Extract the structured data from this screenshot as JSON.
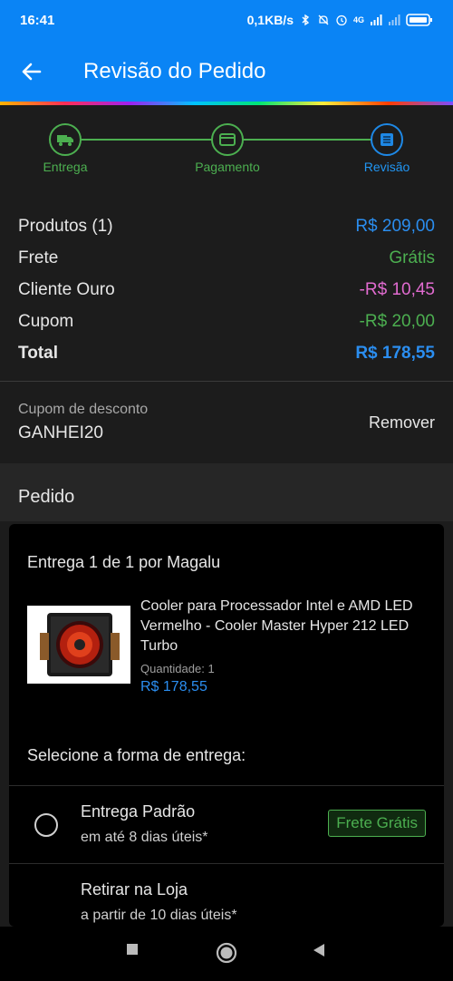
{
  "status_bar": {
    "time": "16:41",
    "speed": "0,1KB/s",
    "network": "4G",
    "icons": [
      "bluetooth-icon",
      "mute-icon",
      "alarm-icon",
      "signal-icon",
      "battery-icon"
    ]
  },
  "app_bar": {
    "title": "Revisão do Pedido",
    "back_icon": "arrow-left-icon"
  },
  "stepper": {
    "steps": [
      {
        "label": "Entrega",
        "icon": "truck-icon",
        "state": "done"
      },
      {
        "label": "Pagamento",
        "icon": "card-icon",
        "state": "done"
      },
      {
        "label": "Revisão",
        "icon": "list-icon",
        "state": "current"
      }
    ],
    "colors": {
      "done": "#4caf50",
      "current": "#1e88e5"
    }
  },
  "summary": {
    "rows": [
      {
        "label": "Produtos (1)",
        "value": "R$ 209,00",
        "color": "#2b8ef0"
      },
      {
        "label": "Frete",
        "value": "Grátis",
        "color": "#4caf50"
      },
      {
        "label": "Cliente Ouro",
        "value": "-R$ 10,45",
        "color": "#e16bd0"
      },
      {
        "label": "Cupom",
        "value": "-R$ 20,00",
        "color": "#4caf50"
      }
    ],
    "total": {
      "label": "Total",
      "value": "R$ 178,55"
    }
  },
  "coupon": {
    "caption": "Cupom de desconto",
    "code": "GANHEI20",
    "remove_label": "Remover"
  },
  "order": {
    "section_title": "Pedido",
    "delivery_header": "Entrega 1 de 1 por Magalu",
    "product": {
      "name": "Cooler para Processador Intel e AMD LED Vermelho - Cooler Master Hyper 212 LED Turbo",
      "quantity_label": "Quantidade:",
      "quantity": "1",
      "price": "R$ 178,55"
    },
    "shipping_title": "Selecione a forma de entrega:",
    "shipping_options": [
      {
        "name": "Entrega Padrão",
        "eta": "em até 8 dias úteis*",
        "badge": "Frete Grátis"
      },
      {
        "name": "Retirar na Loja",
        "eta": "a partir de 10 dias úteis*",
        "badge": ""
      }
    ]
  },
  "nav_bar": {
    "buttons": [
      "recents-icon",
      "home-icon",
      "back-icon"
    ]
  }
}
